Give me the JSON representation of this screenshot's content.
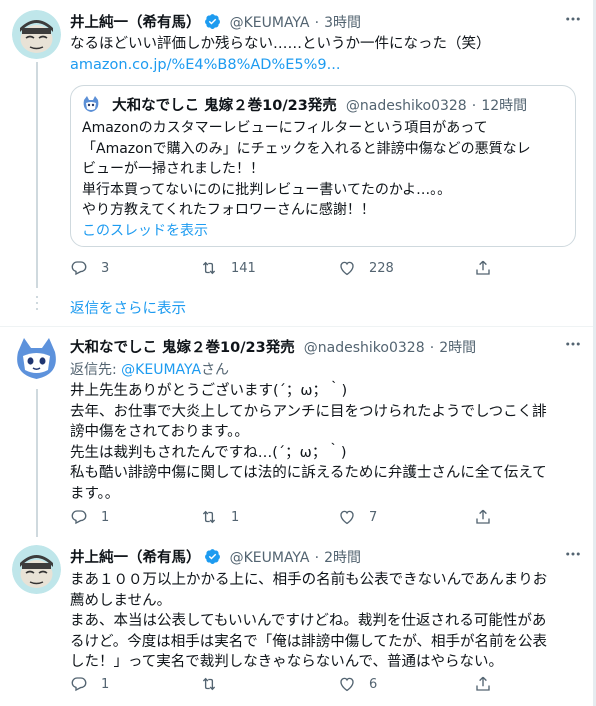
{
  "thread": {
    "main_tweet": {
      "author_name": "井上純一（希有馬）",
      "handle": "@KEUMAYA",
      "time": "3時間",
      "text_lines": [
        "なるほどいい評価しか残らない……というか一件になった（笑）"
      ],
      "link": "amazon.co.jp/%E4%B8%AD%E5%9...",
      "quoted": {
        "author_name": "大和なでしこ 鬼嫁２巻10/23発売",
        "handle": "@nadeshiko0328",
        "time": "12時間",
        "text_lines": [
          "Amazonのカスタマーレビューにフィルターという項目があって",
          "「Amazonで購入のみ」にチェックを入れると誹謗中傷などの悪質なレ",
          "ビューが一掃されました！！",
          "単行本買ってないにのに批判レビュー書いてたのかよ…。。",
          "やり方教えてくれたフォロワーさんに感謝！！"
        ],
        "show_thread": "このスレッドを表示"
      },
      "counts": {
        "replies": "3",
        "retweets": "141",
        "likes": "228"
      }
    },
    "show_more_replies": "返信をさらに表示",
    "reply1": {
      "author_name": "大和なでしこ 鬼嫁２巻10/23発売",
      "handle": "@nadeshiko0328",
      "time": "2時間",
      "reply_to_prefix": "返信先: ",
      "reply_to_handle": "@KEUMAYA",
      "reply_to_suffix": "さん",
      "text_lines": [
        "井上先生ありがとうございます(´；ω；｀)",
        "去年、お仕事で大炎上してからアンチに目をつけられたようでしつこく誹",
        "謗中傷をされております。。",
        "先生は裁判もされたんですね…(´；ω；｀)",
        "私も酷い誹謗中傷に関しては法的に訴えるために弁護士さんに全て伝えて",
        "ます。。"
      ],
      "counts": {
        "replies": "1",
        "retweets": "1",
        "likes": "7"
      }
    },
    "reply2": {
      "author_name": "井上純一（希有馬）",
      "handle": "@KEUMAYA",
      "time": "2時間",
      "text_lines": [
        "まあ１００万以上かかる上に、相手の名前も公表できないんであんまりお",
        "薦めしません。",
        "まあ、本当は公表してもいいんですけどね。裁判を仕返される可能性があ",
        "るけど。今度は相手は実名で「俺は誹謗中傷してたが、相手が名前を公表",
        "した！」って実名で裁判しなきゃならないんで、普通はやらない。"
      ],
      "counts": {
        "replies": "1",
        "retweets": "",
        "likes": "6"
      }
    },
    "separator": "·",
    "colors": {
      "accent": "#1d9bf0",
      "muted": "#536471",
      "verified": "#1d9bf0"
    },
    "icons": [
      "reply-icon",
      "retweet-icon",
      "like-icon",
      "share-icon",
      "more-icon",
      "verified-icon"
    ]
  }
}
